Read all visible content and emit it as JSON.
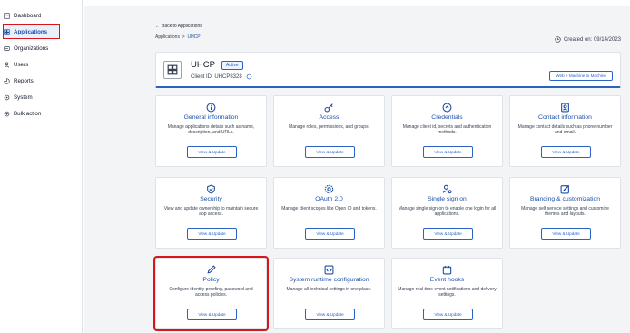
{
  "sidebar": {
    "items": [
      {
        "label": "Dashboard",
        "icon": "dashboard-icon"
      },
      {
        "label": "Applications",
        "icon": "applications-icon",
        "active": true
      },
      {
        "label": "Organizations",
        "icon": "organizations-icon"
      },
      {
        "label": "Users",
        "icon": "user-icon"
      },
      {
        "label": "Reports",
        "icon": "reports-icon"
      },
      {
        "label": "System",
        "icon": "system-icon"
      },
      {
        "label": "Bulk action",
        "icon": "bulk-action-icon"
      }
    ]
  },
  "header": {
    "back_label": "Back to Applications",
    "breadcrumb_root": "Applications",
    "breadcrumb_sep": ">",
    "breadcrumb_current": "UHCP",
    "created": "Created on: 09/14/2023"
  },
  "app": {
    "name": "UHCP",
    "status": "Active",
    "client_id": "Client ID: UHCP8328",
    "type_button": "Web + Machine to Machine"
  },
  "tiles": [
    {
      "title": "General information",
      "desc": "Manage applications details such as name, description, and URLs.",
      "button": "View & Update",
      "icon": "info-icon"
    },
    {
      "title": "Access",
      "desc": "Manage roles, permissions, and groups.",
      "button": "View & Update",
      "icon": "key-icon"
    },
    {
      "title": "Credentials",
      "desc": "Manage client id, secrets and authentication methods.",
      "button": "View & Update",
      "icon": "credentials-icon"
    },
    {
      "title": "Contact information",
      "desc": "Manage contact details such as phone number and email.",
      "button": "View & Update",
      "icon": "contact-icon"
    },
    {
      "title": "Security",
      "desc": "View and update ownership to maintain secure app access.",
      "button": "View & Update",
      "icon": "shield-icon"
    },
    {
      "title": "OAuth 2.0",
      "desc": "Manage client scopes like Open ID and tokens.",
      "button": "View & Update",
      "icon": "oauth-gear-icon"
    },
    {
      "title": "Single sign on",
      "desc": "Manage single sign-on to enable one login for all applications.",
      "button": "View & Update",
      "icon": "sso-user-icon"
    },
    {
      "title": "Branding & customization",
      "desc": "Manage self service settings and customize themes and layouts.",
      "button": "View & Update",
      "icon": "branding-edit-icon"
    },
    {
      "title": "Policy",
      "desc": "Configure identity proofing, password and access policies.",
      "button": "View & Update",
      "icon": "pencil-icon"
    },
    {
      "title": "System runtime configuration",
      "desc": "Manage all technical settings in one place.",
      "button": "View & Update",
      "icon": "code-icon"
    },
    {
      "title": "Event hooks",
      "desc": "Manage real time event notifications and delivery settings.",
      "button": "View & Update",
      "icon": "calendar-icon"
    }
  ],
  "colors": {
    "accent": "#2a62c4",
    "highlight": "#d9141b",
    "active_bg": "#e8f0fb"
  }
}
